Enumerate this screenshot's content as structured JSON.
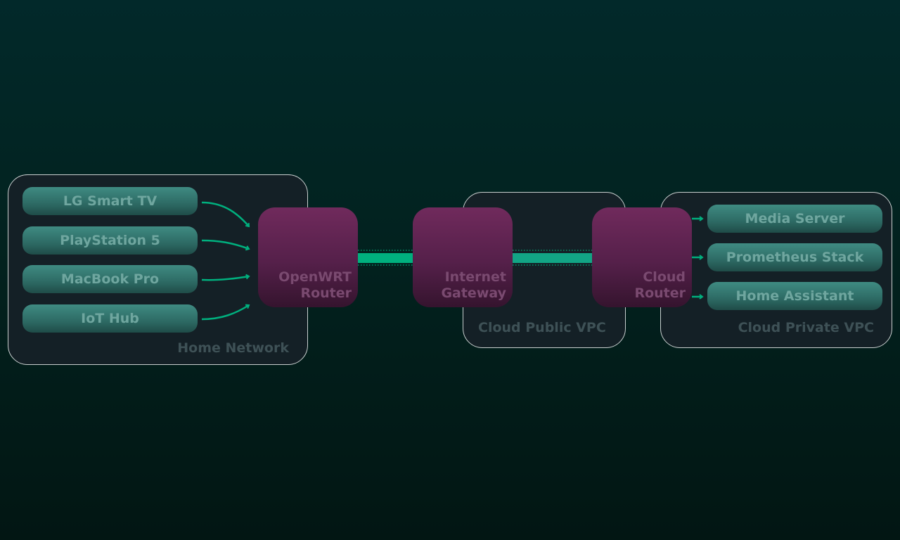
{
  "groups": {
    "home": "Home Network",
    "public_vpc": "Cloud Public VPC",
    "private_vpc": "Cloud Private VPC"
  },
  "devices": [
    "LG Smart TV",
    "PlayStation 5",
    "MacBook Pro",
    "IoT Hub"
  ],
  "nodes": {
    "openwrt": [
      "OpenWRT",
      "Router"
    ],
    "gateway": [
      "Internet",
      "Gateway"
    ],
    "cloud_router": [
      "Cloud",
      "Router"
    ]
  },
  "services": [
    "Media Server",
    "Prometheus Stack",
    "Home Assistant"
  ],
  "colors": {
    "link": "#00b07e",
    "node": "#702a5c",
    "pill": "#3f8b82",
    "group_bg": "#142026"
  }
}
